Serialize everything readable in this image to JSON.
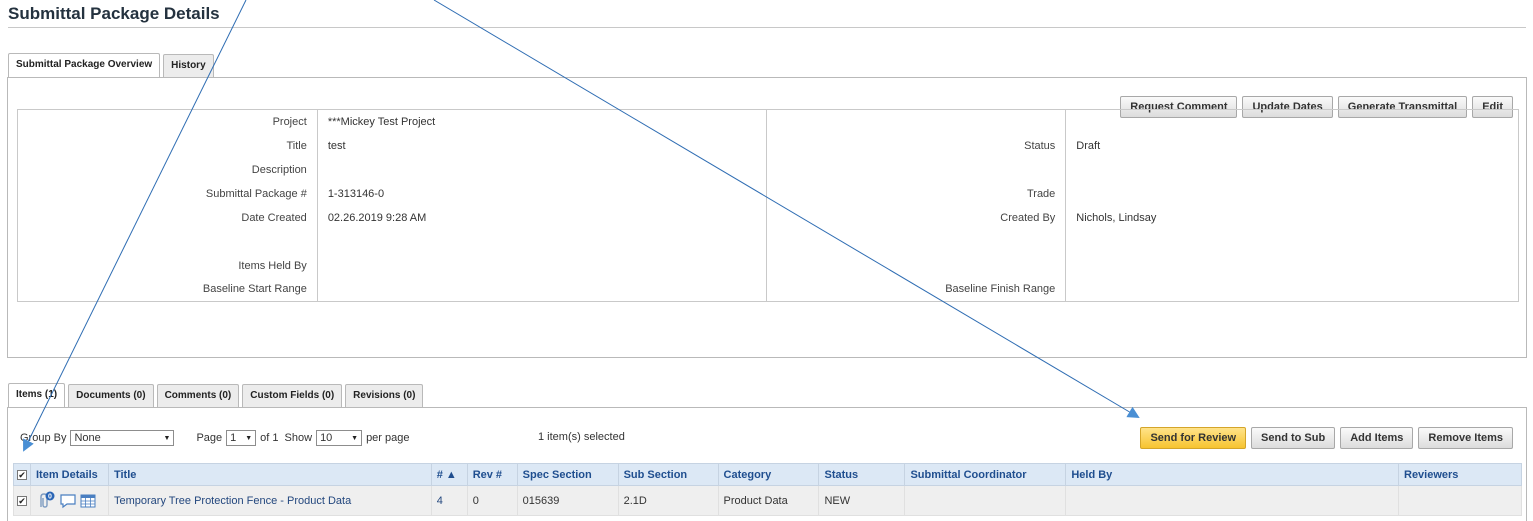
{
  "page": {
    "title": "Submittal Package Details"
  },
  "top_tabs": [
    "Submittal Package Overview",
    "History"
  ],
  "actions": [
    "Request Comment",
    "Update Dates",
    "Generate Transmittal",
    "Edit"
  ],
  "details": {
    "left": [
      {
        "label": "Project",
        "value": "***Mickey Test Project"
      },
      {
        "label": "Title",
        "value": "test"
      },
      {
        "label": "Description",
        "value": ""
      },
      {
        "label": "Submittal Package #",
        "value": "1-313146-0"
      },
      {
        "label": "Date Created",
        "value": "02.26.2019 9:28 AM"
      },
      {
        "label": "",
        "value": ""
      },
      {
        "label": "Items Held By",
        "value": ""
      },
      {
        "label": "Baseline Start Range",
        "value": ""
      }
    ],
    "right": [
      {
        "label": "",
        "value": ""
      },
      {
        "label": "Status",
        "value": "Draft"
      },
      {
        "label": "",
        "value": ""
      },
      {
        "label": "Trade",
        "value": ""
      },
      {
        "label": "Created By",
        "value": "Nichols, Lindsay"
      },
      {
        "label": "",
        "value": ""
      },
      {
        "label": "",
        "value": ""
      },
      {
        "label": "Baseline Finish Range",
        "value": ""
      }
    ]
  },
  "bottom_tabs": [
    "Items (1)",
    "Documents (0)",
    "Comments (0)",
    "Custom Fields (0)",
    "Revisions (0)"
  ],
  "toolbar": {
    "group_by_label": "Group By",
    "group_by_value": "None",
    "page_label": "Page",
    "page_value": "1",
    "of_label": "of 1",
    "show_label": "Show",
    "show_value": "10",
    "per_page_label": "per page",
    "selected_text": "1 item(s) selected"
  },
  "item_actions": [
    "Send for Review",
    "Send to Sub",
    "Add Items",
    "Remove Items"
  ],
  "grid": {
    "headers": [
      "Item Details",
      "Title",
      "# ▲",
      "Rev #",
      "Spec Section",
      "Sub Section",
      "Category",
      "Status",
      "Submittal Coordinator",
      "Held By",
      "Reviewers"
    ],
    "rows": [
      {
        "title": "Temporary Tree Protection Fence - Product Data",
        "number": "4",
        "rev": "0",
        "spec_section": "015639",
        "sub_section": "2.1D",
        "category": "Product Data",
        "status": "NEW",
        "coordinator": "",
        "held_by": "",
        "reviewers": ""
      }
    ]
  },
  "icons": [
    "checkbox-icon",
    "attachment-icon",
    "comment-icon",
    "table-icon",
    "dropdown-arrow-icon",
    "sort-ascending-icon"
  ],
  "colors": {
    "primary_button": "#f7c430",
    "grid_header_bg": "#dce8f5",
    "grid_header_text": "#1f4e8f",
    "link": "#23477e",
    "annotation_arrow": "#4a8fd4"
  }
}
